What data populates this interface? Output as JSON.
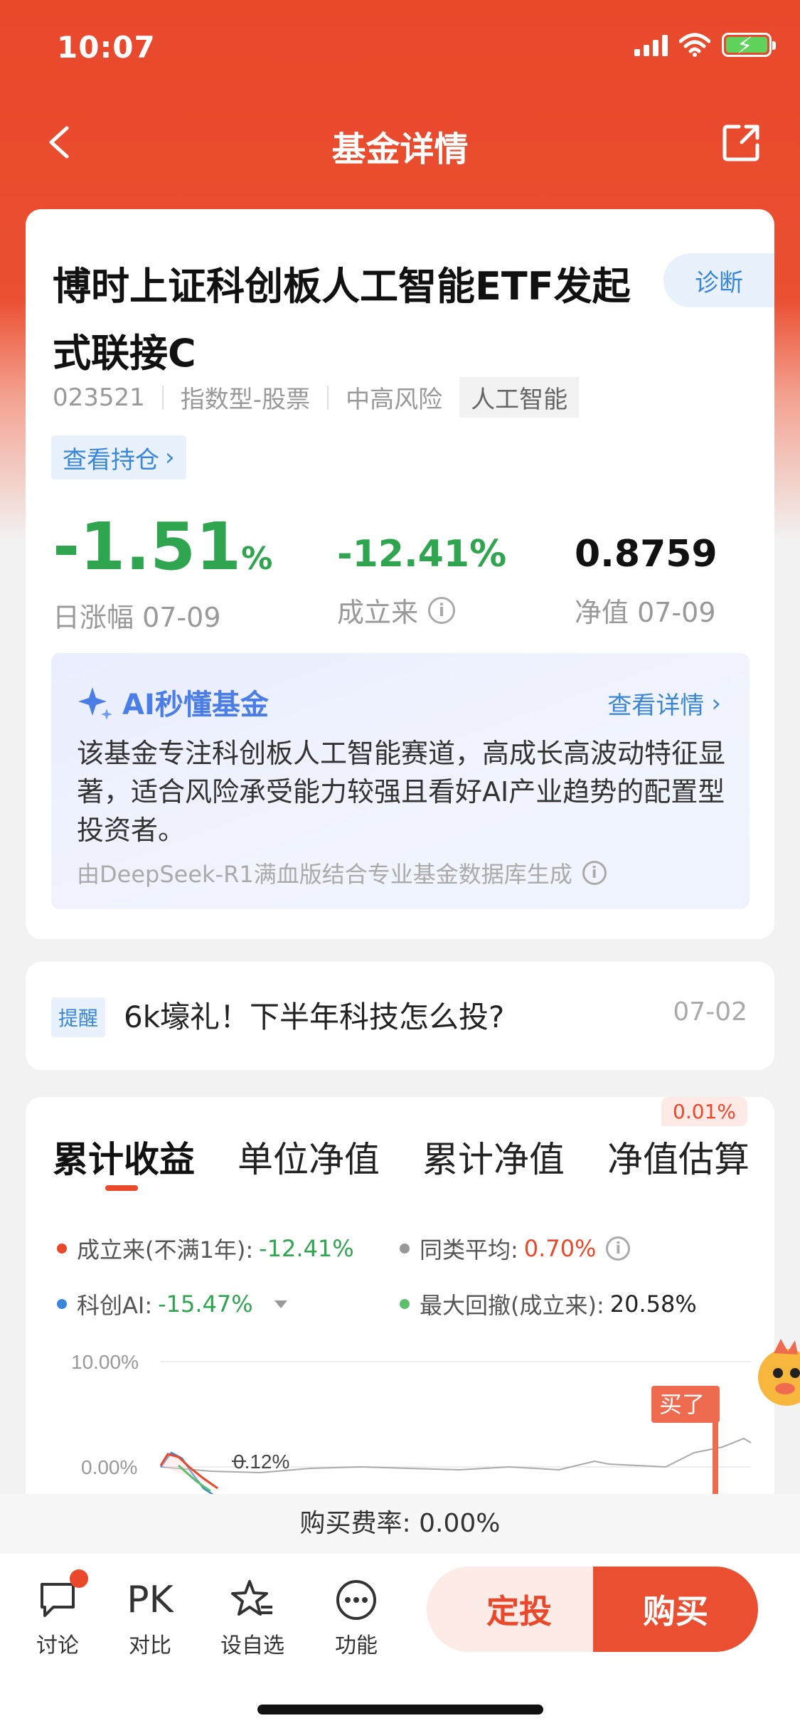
{
  "status": {
    "time": "10:07"
  },
  "nav": {
    "title": "基金详情"
  },
  "fund": {
    "name": "博时上证科创板人工智能ETF发起式联接C",
    "diagnose_label": "诊断",
    "code": "023521",
    "type": "指数型-股票",
    "risk": "中高风险",
    "theme_tag": "人工智能",
    "holding_link": "查看持仓"
  },
  "stats": {
    "daily_change": "-1.51",
    "daily_change_unit": "%",
    "daily_label": "日涨幅 07-09",
    "since_inception": "-12.41%",
    "since_inception_label": "成立来",
    "nav_value": "0.8759",
    "nav_label": "净值 07-09"
  },
  "ai": {
    "title": "AI秒懂基金",
    "more": "查看详情",
    "summary": "该基金专注科创板人工智能赛道，高成长高波动特征显著，适合风险承受能力较强且看好AI产业趋势的配置型投资者。",
    "footnote": "由DeepSeek-R1满血版结合专业基金数据库生成"
  },
  "reminder": {
    "tag": "提醒",
    "text": "6k壕礼！下半年科技怎么投?",
    "date": "07-02"
  },
  "chart_section": {
    "tabs": [
      "累计收益",
      "单位净值",
      "累计净值",
      "净值估算"
    ],
    "estimate_badge": "0.01%",
    "legend": {
      "inception_label": "成立来(不满1年):",
      "inception_value": "-12.41%",
      "peer_label": "同类平均:",
      "peer_value": "0.70%",
      "index_label": "科创AI:",
      "index_value": "-15.47%",
      "drawdown_label": "最大回撤(成立来):",
      "drawdown_value": "20.58%"
    },
    "buy_marker": "买了",
    "hover_value": "0.12%"
  },
  "chart_data": {
    "type": "line",
    "ylabels": [
      "10.00%",
      "0.00%"
    ],
    "ylim": [
      -3,
      10
    ],
    "series": [
      {
        "name": "成立来(不满1年)",
        "color": "#e9482b"
      },
      {
        "name": "同类平均",
        "color": "#999999"
      },
      {
        "name": "科创AI",
        "color": "#3a86d8"
      }
    ],
    "marker": "买了",
    "annotation": "0.12%"
  },
  "colors": {
    "brand": "#e9482b",
    "up": "#e9482b",
    "down": "#2ea54e",
    "link": "#3a86d8"
  },
  "footer": {
    "fee_label": "购买费率:",
    "fee_value": "0.00%",
    "discuss": "讨论",
    "pk_icon": "PK",
    "compare": "对比",
    "watchlist": "设自选",
    "more": "功能",
    "invest_plan": "定投",
    "buy": "购买"
  }
}
